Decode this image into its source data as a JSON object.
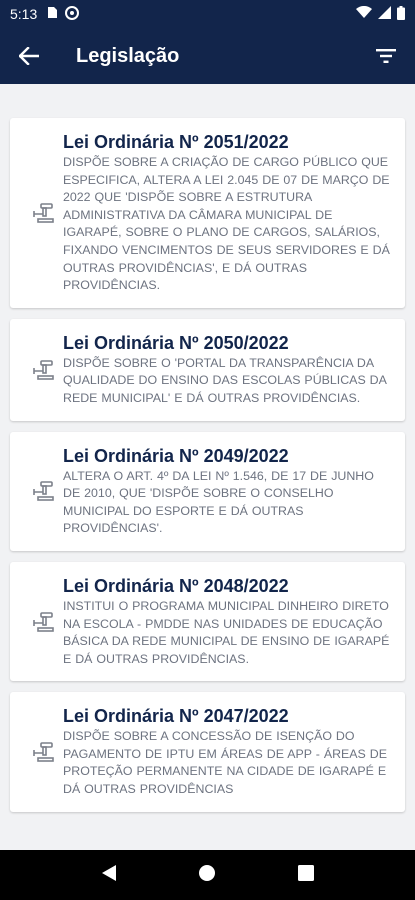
{
  "status": {
    "time": "5:13"
  },
  "header": {
    "title": "Legislação"
  },
  "laws": [
    {
      "title": "Lei Ordinária Nº 2051/2022",
      "description": "DISPÕE SOBRE A CRIAÇÃO DE CARGO PÚBLICO QUE ESPECIFICA, ALTERA A LEI 2.045 DE 07 DE MARÇO DE 2022 QUE 'DISPÕE SOBRE A ESTRUTURA ADMINISTRATIVA DA CÂMARA MUNICIPAL DE IGARAPÉ, SOBRE O PLANO DE CARGOS, SALÁRIOS, FIXANDO VENCIMENTOS DE SEUS SERVIDORES E DÁ OUTRAS PROVIDÊNCIAS', E DÁ OUTRAS PROVIDÊNCIAS."
    },
    {
      "title": "Lei Ordinária Nº 2050/2022",
      "description": "DISPÕE SOBRE O 'PORTAL DA TRANSPARÊNCIA DA QUALIDADE DO ENSINO DAS ESCOLAS PÚBLICAS DA REDE MUNICIPAL' E DÁ OUTRAS PROVIDÊNCIAS."
    },
    {
      "title": "Lei Ordinária Nº 2049/2022",
      "description": "ALTERA O ART. 4º DA LEI Nº 1.546, DE 17 DE JUNHO DE 2010, QUE 'DISPÕE SOBRE O CONSELHO MUNICIPAL DO ESPORTE E DÁ OUTRAS PROVIDÊNCIAS'."
    },
    {
      "title": "Lei Ordinária Nº 2048/2022",
      "description": "INSTITUI O PROGRAMA MUNICIPAL DINHEIRO DIRETO NA ESCOLA - PMDDE NAS UNIDADES DE EDUCAÇÃO BÁSICA DA REDE MUNICIPAL DE ENSINO DE IGARAPÉ E DÁ OUTRAS PROVIDÊNCIAS."
    },
    {
      "title": "Lei Ordinária Nº 2047/2022",
      "description": "DISPÕE SOBRE A CONCESSÃO DE ISENÇÃO DO PAGAMENTO DE IPTU EM ÁREAS DE APP - ÁREAS DE PROTEÇÃO PERMANENTE NA CIDADE DE IGARAPÉ E DÁ OUTRAS PROVIDÊNCIAS"
    }
  ],
  "icons": {
    "back": "arrow-left-icon",
    "filter": "filter-icon",
    "item": "gavel-icon"
  },
  "colors": {
    "primary": "#12254b",
    "background": "#f1f2f4",
    "text_secondary": "#6d7380"
  }
}
